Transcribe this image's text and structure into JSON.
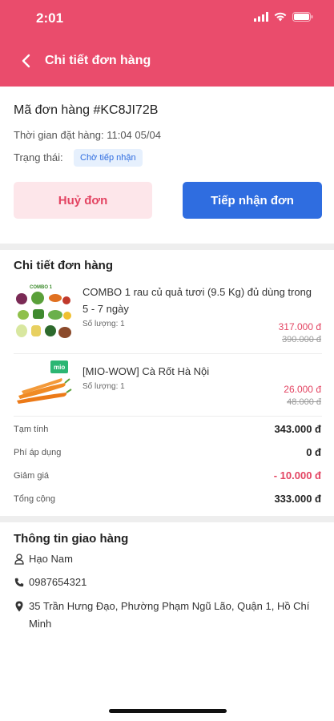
{
  "status_bar": {
    "time": "2:01"
  },
  "header": {
    "title": "Chi tiết đơn hàng"
  },
  "order": {
    "code": "Mã đơn hàng #KC8JI72B",
    "time": "Thời gian đặt hàng: 11:04 05/04",
    "status_label": "Trạng thái:",
    "status_value": "Chờ tiếp nhận"
  },
  "actions": {
    "cancel_label": "Huỷ đơn",
    "accept_label": "Tiếp nhận đơn"
  },
  "details": {
    "title": "Chi tiết đơn hàng",
    "items": [
      {
        "name": "COMBO 1 rau củ quả tươi (9.5 Kg) đủ dùng trong 5 - 7 ngày",
        "qty": "Số lượng: 1",
        "price": "317.000 đ",
        "old_price": "390.000 đ",
        "image_label": "COMBO 1"
      },
      {
        "name": "[MIO-WOW] Cà Rốt Hà Nội",
        "qty": "Số lượng: 1",
        "price": "26.000 đ",
        "old_price": "48.000 đ",
        "image_label": "mio"
      }
    ],
    "summary": [
      {
        "label": "Tạm tính",
        "value": "343.000 đ"
      },
      {
        "label": "Phí áp dụng",
        "value": "0 đ"
      },
      {
        "label": "Giảm giá",
        "value": "- 10.000 đ"
      },
      {
        "label": "Tổng cộng",
        "value": "333.000 đ"
      }
    ]
  },
  "shipping": {
    "title": "Thông tin giao hàng",
    "name": "Hạo Nam",
    "phone": "0987654321",
    "address": "35 Trần Hưng Đạo, Phường Phạm Ngũ Lão, Quận 1, Hồ Chí Minh"
  },
  "icons": {
    "back": "chevron-left-icon",
    "user": "user-icon",
    "phone": "phone-icon",
    "location": "location-pin-icon",
    "signal": "signal-icon",
    "wifi": "wifi-icon",
    "battery": "battery-icon"
  },
  "colors": {
    "brand": "#ea4c6c",
    "primary": "#2f6de0",
    "price": "#e34462",
    "badge_bg": "#e6f0fd"
  }
}
